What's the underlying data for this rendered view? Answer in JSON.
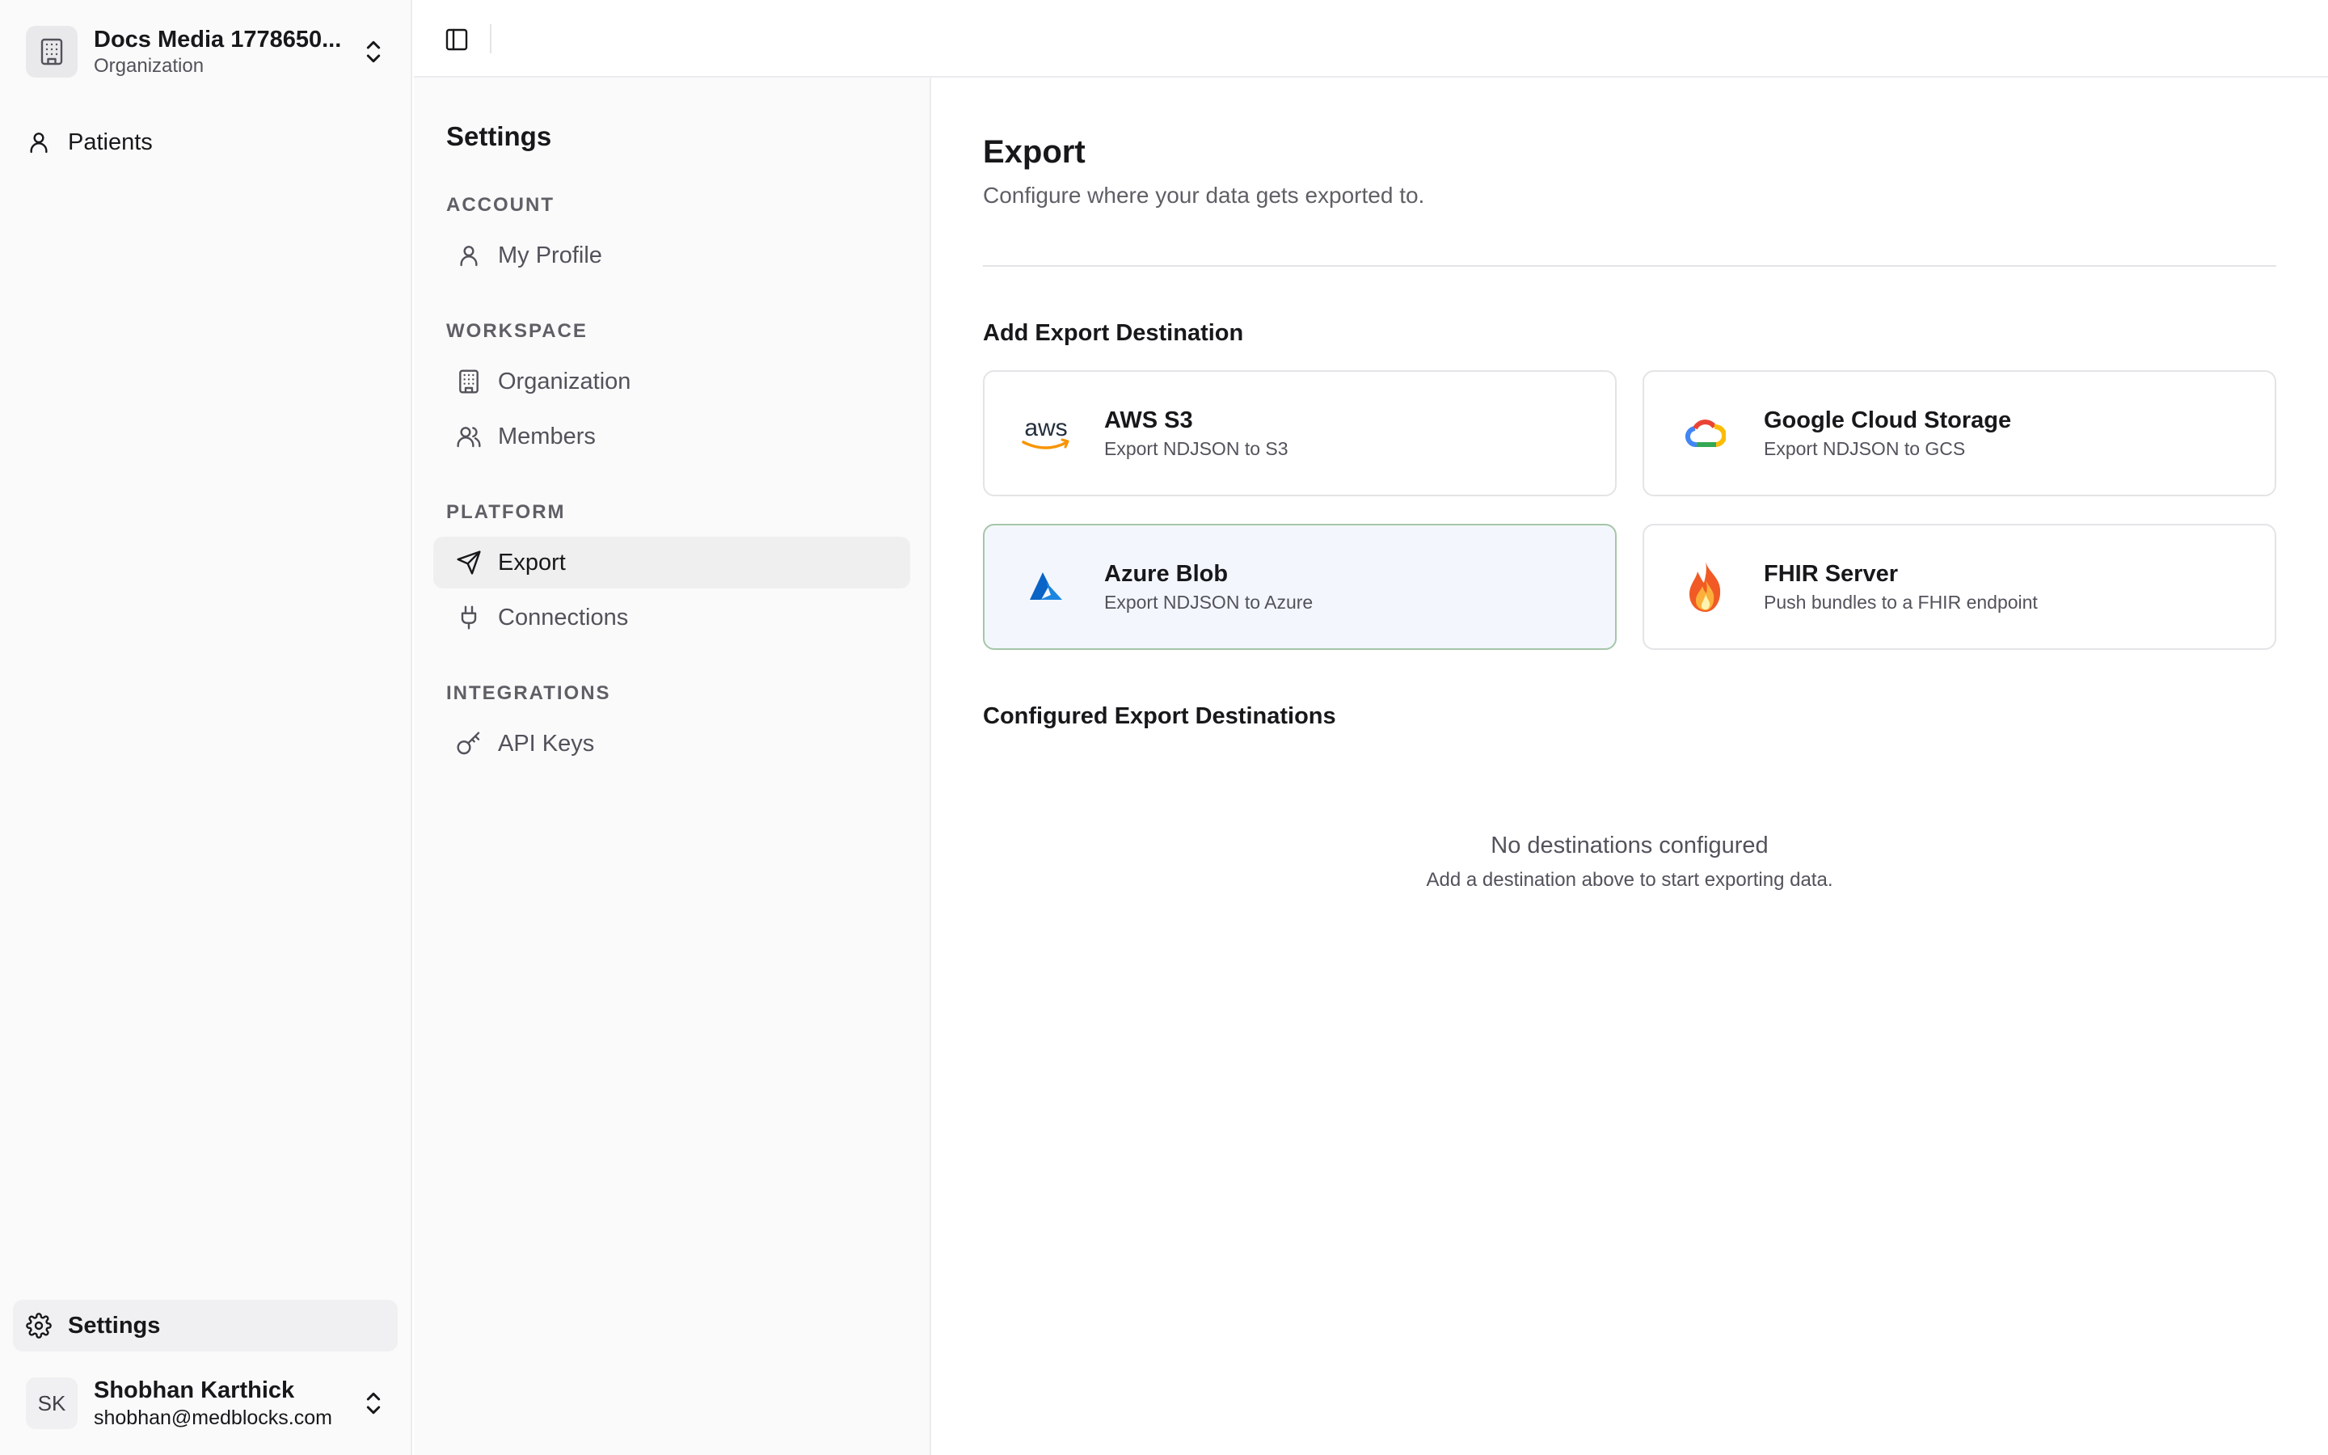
{
  "org": {
    "name": "Docs Media 1778650...",
    "type": "Organization"
  },
  "app_nav": {
    "patients": "Patients",
    "settings": "Settings"
  },
  "user": {
    "initials": "SK",
    "name": "Shobhan Karthick",
    "email": "shobhan@medblocks.com"
  },
  "settings_nav": {
    "title": "Settings",
    "groups": [
      {
        "label": "ACCOUNT",
        "items": [
          {
            "label": "My Profile",
            "icon": "user-icon"
          }
        ]
      },
      {
        "label": "WORKSPACE",
        "items": [
          {
            "label": "Organization",
            "icon": "building-icon"
          },
          {
            "label": "Members",
            "icon": "users-icon"
          }
        ]
      },
      {
        "label": "PLATFORM",
        "items": [
          {
            "label": "Export",
            "icon": "send-icon",
            "active": true
          },
          {
            "label": "Connections",
            "icon": "plug-icon"
          }
        ]
      },
      {
        "label": "INTEGRATIONS",
        "items": [
          {
            "label": "API Keys",
            "icon": "key-icon"
          }
        ]
      }
    ]
  },
  "main": {
    "title": "Export",
    "subtitle": "Configure where your data gets exported to.",
    "add_section_title": "Add Export Destination",
    "destinations": [
      {
        "name": "AWS S3",
        "desc": "Export NDJSON to S3",
        "icon": "aws-logo"
      },
      {
        "name": "Google Cloud Storage",
        "desc": "Export NDJSON to GCS",
        "icon": "gcs-logo"
      },
      {
        "name": "Azure Blob",
        "desc": "Export NDJSON to Azure",
        "icon": "azure-logo",
        "selected": true
      },
      {
        "name": "FHIR Server",
        "desc": "Push bundles to a FHIR endpoint",
        "icon": "fhir-logo"
      }
    ],
    "configured_section_title": "Configured Export Destinations",
    "empty_title": "No destinations configured",
    "empty_subtitle": "Add a destination above to start exporting data."
  },
  "colors": {
    "selected_card_bg": "#f3f7fd",
    "selected_card_border": "#a6c6a8",
    "active_nav_bg": "#efefef"
  }
}
